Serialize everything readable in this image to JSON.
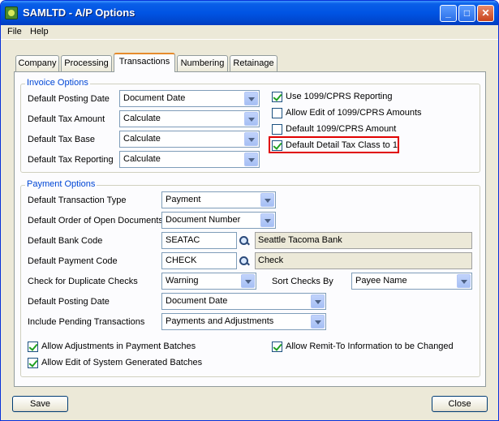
{
  "window": {
    "title": "SAMLTD - A/P Options"
  },
  "title_buttons": {
    "minimize": "_",
    "maximize": "□",
    "close": "✕"
  },
  "menu": {
    "file": "File",
    "help": "Help"
  },
  "tabs": [
    {
      "label": "Company"
    },
    {
      "label": "Processing"
    },
    {
      "label": "Transactions"
    },
    {
      "label": "Numbering"
    },
    {
      "label": "Retainage"
    }
  ],
  "invoice_options": {
    "legend": "Invoice Options",
    "posting_date": {
      "label": "Default Posting Date",
      "value": "Document Date"
    },
    "tax_amount": {
      "label": "Default Tax Amount",
      "value": "Calculate"
    },
    "tax_base": {
      "label": "Default Tax Base",
      "value": "Calculate"
    },
    "tax_reporting": {
      "label": "Default Tax Reporting",
      "value": "Calculate"
    },
    "use_1099": {
      "label": "Use 1099/CPRS Reporting",
      "checked": true
    },
    "allow_edit_1099": {
      "label": "Allow Edit of 1099/CPRS Amounts",
      "checked": false
    },
    "default_1099_amount": {
      "label": "Default 1099/CPRS Amount",
      "checked": false
    },
    "default_detail_tax_class": {
      "label": "Default Detail Tax Class to 1",
      "checked": true
    }
  },
  "payment_options": {
    "legend": "Payment Options",
    "transaction_type": {
      "label": "Default Transaction Type",
      "value": "Payment"
    },
    "order_open_docs": {
      "label": "Default Order of Open Documents",
      "value": "Document Number"
    },
    "bank_code": {
      "label": "Default Bank Code",
      "value": "SEATAC",
      "description": "Seattle Tacoma Bank"
    },
    "payment_code": {
      "label": "Default Payment Code",
      "value": "CHECK",
      "description": "Check"
    },
    "duplicate_checks": {
      "label": "Check for Duplicate Checks",
      "value": "Warning"
    },
    "sort_checks": {
      "label": "Sort Checks By",
      "value": "Payee Name"
    },
    "posting_date": {
      "label": "Default Posting Date",
      "value": "Document Date"
    },
    "pending_transactions": {
      "label": "Include Pending Transactions",
      "value": "Payments and Adjustments"
    },
    "allow_adjustments": {
      "label": "Allow Adjustments in Payment Batches",
      "checked": true
    },
    "allow_edit_system": {
      "label": "Allow Edit of System Generated Batches",
      "checked": true
    },
    "allow_remit_to": {
      "label": "Allow Remit-To Information to be Changed",
      "checked": true
    }
  },
  "buttons": {
    "save": "Save",
    "close": "Close"
  }
}
